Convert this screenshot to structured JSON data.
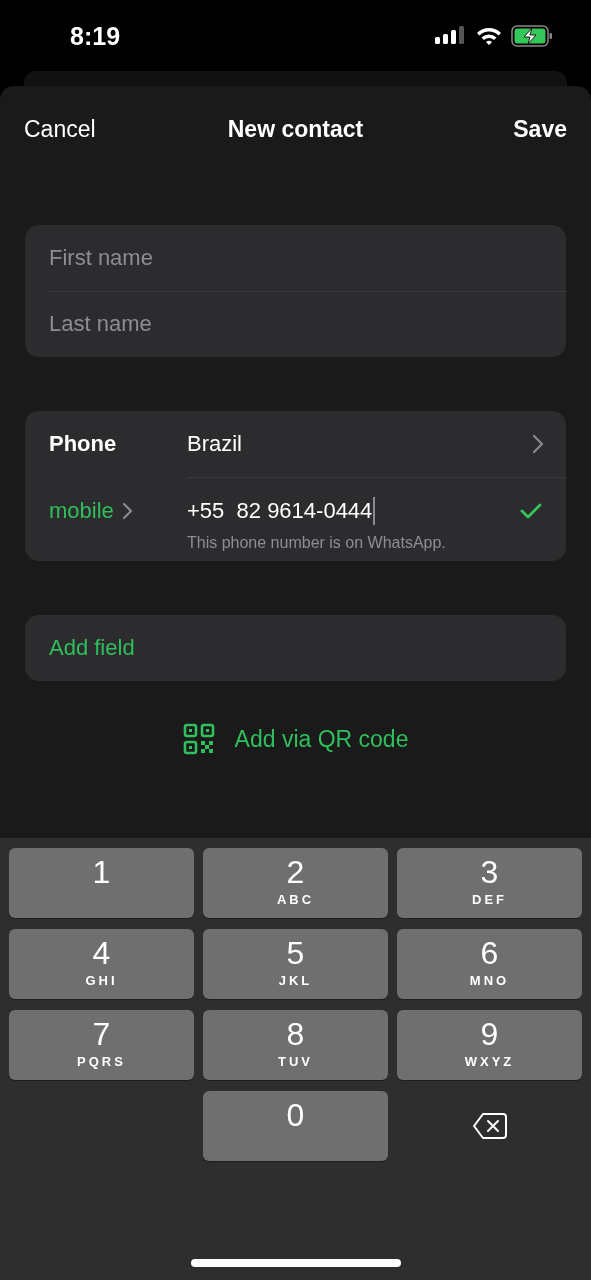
{
  "status_bar": {
    "time": "8:19"
  },
  "nav": {
    "cancel": "Cancel",
    "title": "New contact",
    "save": "Save"
  },
  "name_fields": [
    {
      "placeholder": "First name"
    },
    {
      "placeholder": "Last name"
    }
  ],
  "phone": {
    "label": "Phone",
    "country": "Brazil",
    "type": "mobile",
    "number": "+55  82 9614-0444",
    "focused": true,
    "verified": true,
    "note": "This phone number is on WhatsApp."
  },
  "add_field": "Add field",
  "qr_button": "Add via QR code",
  "keypad": [
    {
      "kind": "digit",
      "digit": "1"
    },
    {
      "kind": "digit",
      "digit": "2",
      "letters": "ABC"
    },
    {
      "kind": "digit",
      "digit": "3",
      "letters": "DEF"
    },
    {
      "kind": "digit",
      "digit": "4",
      "letters": "GHI"
    },
    {
      "kind": "digit",
      "digit": "5",
      "letters": "JKL"
    },
    {
      "kind": "digit",
      "digit": "6",
      "letters": "MNO"
    },
    {
      "kind": "digit",
      "digit": "7",
      "letters": "PQRS"
    },
    {
      "kind": "digit",
      "digit": "8",
      "letters": "TUV"
    },
    {
      "kind": "digit",
      "digit": "9",
      "letters": "WXYZ"
    },
    {
      "kind": "blank"
    },
    {
      "kind": "digit",
      "digit": "0"
    },
    {
      "kind": "backspace"
    }
  ]
}
